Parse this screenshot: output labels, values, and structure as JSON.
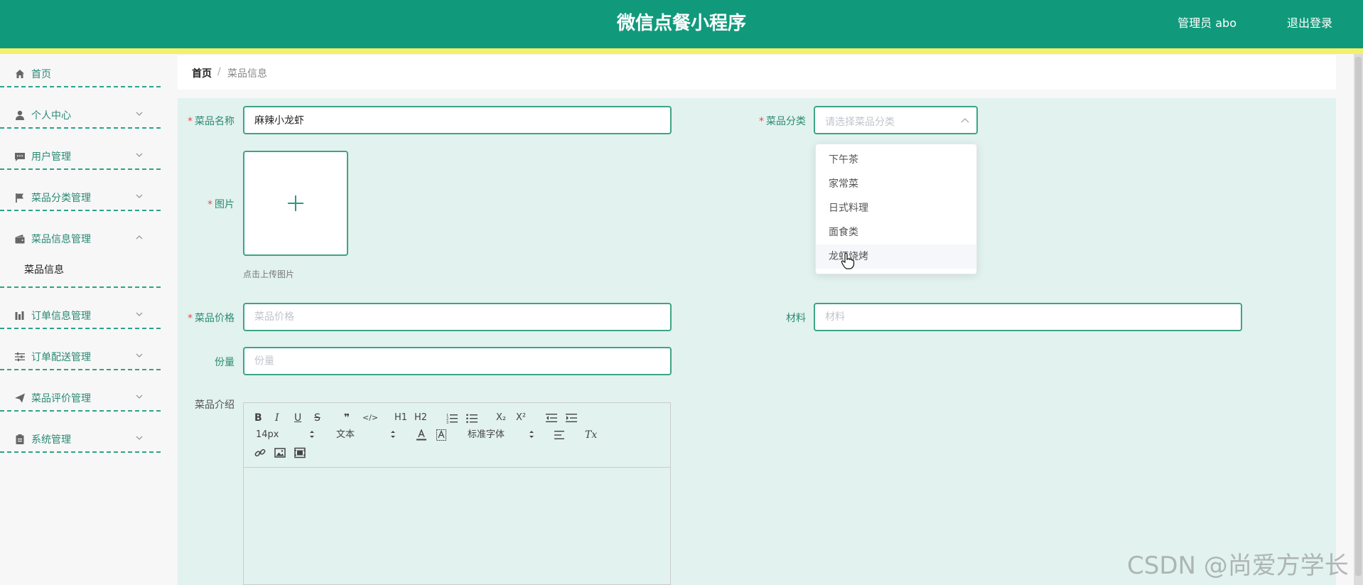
{
  "header": {
    "title": "微信点餐小程序",
    "user": "管理员 abo",
    "logout": "退出登录"
  },
  "sidebar": {
    "items": [
      {
        "label": "首页",
        "icon": "home-icon"
      },
      {
        "label": "个人中心",
        "icon": "user-icon"
      },
      {
        "label": "用户管理",
        "icon": "chat-icon"
      },
      {
        "label": "菜品分类管理",
        "icon": "flag-icon"
      },
      {
        "label": "菜品信息管理",
        "icon": "wallet-icon"
      },
      {
        "label": "订单信息管理",
        "icon": "chart-icon"
      },
      {
        "label": "订单配送管理",
        "icon": "sliders-icon"
      },
      {
        "label": "菜品评价管理",
        "icon": "send-icon"
      },
      {
        "label": "系统管理",
        "icon": "clipboard-icon"
      }
    ],
    "subitem": "菜品信息"
  },
  "breadcrumb": {
    "home": "首页",
    "separator": "/",
    "current": "菜品信息"
  },
  "form": {
    "name_label": "菜品名称",
    "name_value": "麻辣小龙虾",
    "category_label": "菜品分类",
    "category_placeholder": "请选择菜品分类",
    "category_options": [
      "下午茶",
      "家常菜",
      "日式料理",
      "面食类",
      "龙虾烧烤"
    ],
    "image_label": "图片",
    "upload_hint": "点击上传图片",
    "price_label": "菜品价格",
    "price_placeholder": "菜品价格",
    "material_label": "材料",
    "material_placeholder": "材料",
    "portion_label": "份量",
    "portion_placeholder": "份量",
    "intro_label": "菜品介绍",
    "required_mark": "*"
  },
  "editor": {
    "size": "14px",
    "block": "文本",
    "font": "标准字体",
    "bold": "B",
    "italic": "I",
    "underline": "U",
    "strike": "S",
    "quote": "❞",
    "code": "</>",
    "h1": "H1",
    "h2": "H2",
    "sub": "X₂",
    "sup": "X²",
    "clean": "Tx"
  },
  "watermark": "CSDN @尚爱方学长",
  "colors": {
    "header": "#109a7b",
    "stripe": "#f5f06a",
    "accent": "#3ca586",
    "panel": "#e2f2ee"
  }
}
